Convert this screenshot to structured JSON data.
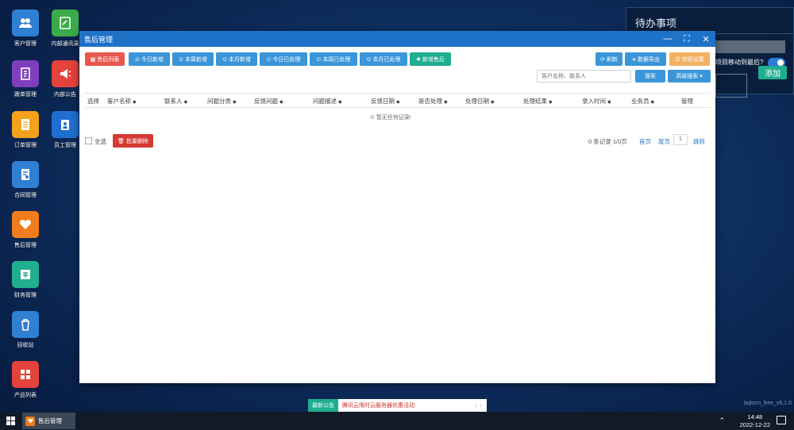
{
  "desktop": {
    "icons": [
      {
        "label": "客户管理",
        "icon": "users-icon",
        "color": "#2f7fd3"
      },
      {
        "label": "内部通讯录",
        "icon": "address-book-icon",
        "color": "#3aaa4a"
      },
      {
        "label": "跟单管理",
        "icon": "notebook-icon",
        "color": "#7e3fbf"
      },
      {
        "label": "内部公告",
        "icon": "megaphone-icon",
        "color": "#e3433a"
      },
      {
        "label": "订单管理",
        "icon": "document-icon",
        "color": "#f4a11d"
      },
      {
        "label": "员工管理",
        "icon": "badge-icon",
        "color": "#1f6fd1"
      },
      {
        "label": "合同管理",
        "icon": "contract-icon",
        "color": "#2f7fd3"
      },
      {
        "label": "售后管理",
        "icon": "heart-hand-icon",
        "color": "#f07c1b"
      },
      {
        "label": "财务管理",
        "icon": "finance-icon",
        "color": "#1fae8f"
      },
      {
        "label": "回收站",
        "icon": "trash-icon",
        "color": "#2f7fd3"
      },
      {
        "label": "产品列表",
        "icon": "grid-icon",
        "color": "#e3433a"
      }
    ]
  },
  "todo": {
    "title": "待办事项",
    "moved_text": "项目移动到最后?",
    "add_label": "添加"
  },
  "window": {
    "title": "售后管理",
    "controls": {
      "minimize": "—",
      "maximize": "⛶",
      "close": "✕"
    },
    "toolbar": {
      "list": "售后列表",
      "today_new": "今日新增",
      "week_new": "本周新增",
      "month_new": "本月新增",
      "today_done": "今日已处理",
      "week_done": "本周已处理",
      "month_done": "本月已处理",
      "add": "新增售后",
      "refresh": "刷新",
      "export": "数据导出",
      "fields": "字段设置"
    },
    "search": {
      "placeholder": "客户名称、联系人",
      "button": "搜索",
      "advanced": "高级搜索"
    },
    "table": {
      "columns": [
        "选择",
        "客户名称",
        "联系人",
        "问题分类",
        "反馈问题",
        "问题描述",
        "反馈日期",
        "是否处理",
        "处理日期",
        "处理结果",
        "录入时间",
        "业务员",
        "管理"
      ],
      "empty": "暂无任何记录!"
    },
    "footer": {
      "select_all": "全选",
      "batch_delete": "批量删除",
      "summary": "0 条记录 1/0页",
      "first": "首页",
      "last": "尾页",
      "page": "1",
      "jump": "跳转"
    }
  },
  "notice": {
    "tag": "最新公告",
    "message": "腾讯云限时云服务器优惠活动"
  },
  "version": "bqlcrm_free_v5.1.0",
  "taskbar": {
    "task_label": "售后管理",
    "time": "14:48",
    "date": "2022-12-22"
  }
}
